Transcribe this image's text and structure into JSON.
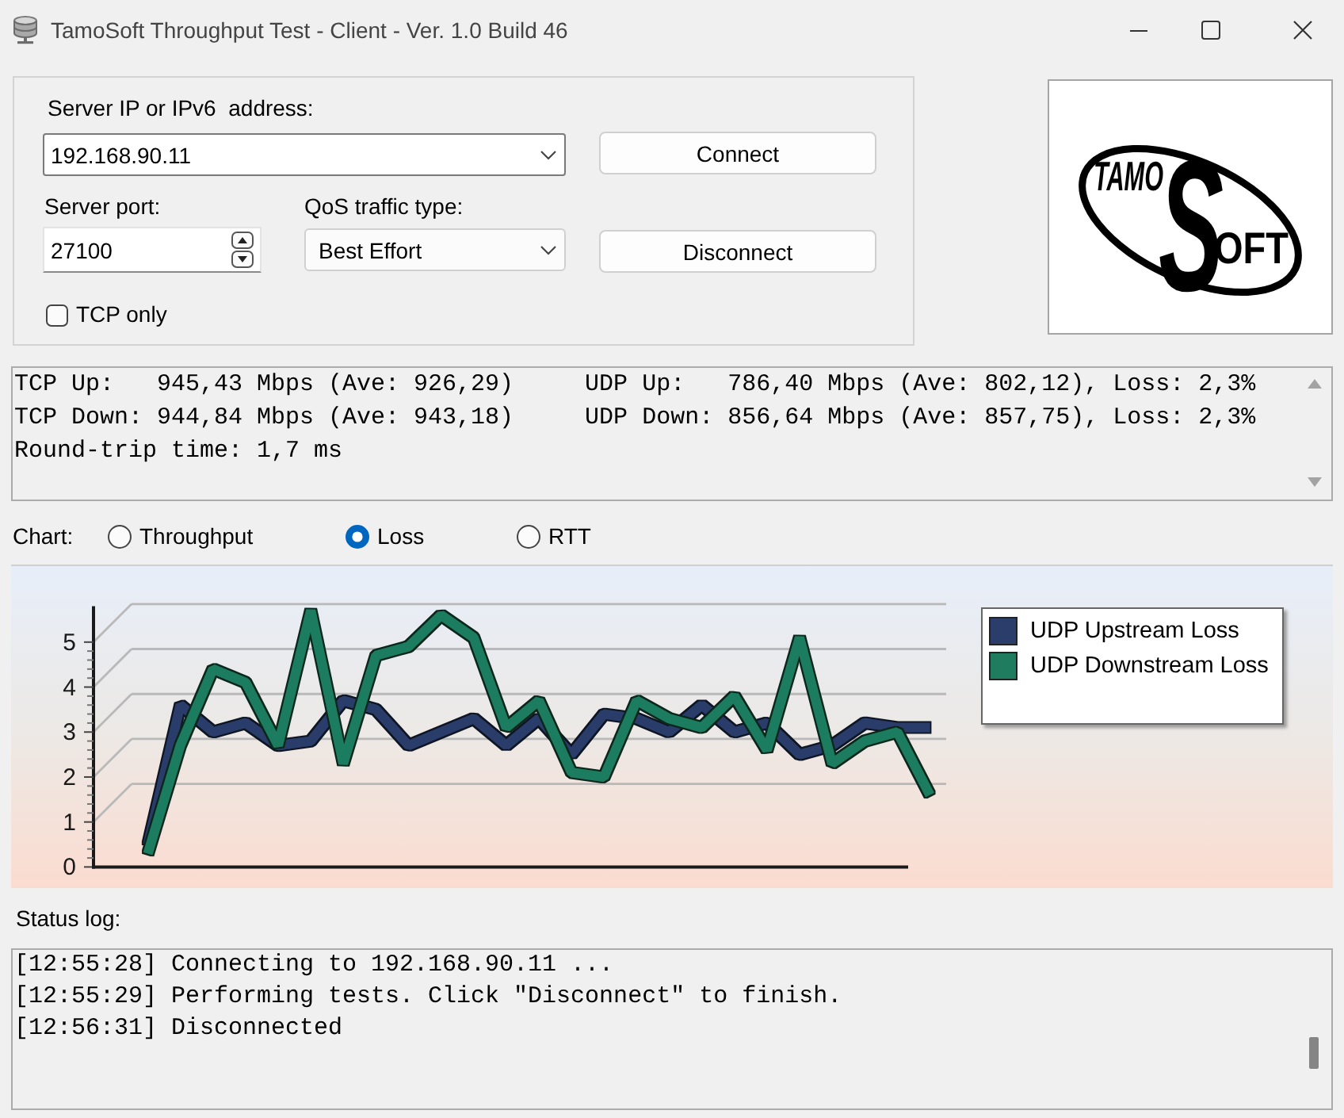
{
  "window": {
    "title": "TamoSoft Throughput Test - Client - Ver. 1.0 Build 46"
  },
  "connection": {
    "server_label": "Server IP or IPv6  address:",
    "server_value": "192.168.90.11",
    "connect_button": "Connect",
    "port_label": "Server port:",
    "port_value": "27100",
    "qos_label": "QoS traffic type:",
    "qos_value": "Best Effort",
    "disconnect_button": "Disconnect",
    "tcp_only": {
      "label": "TCP only",
      "checked": false
    }
  },
  "logo": {
    "words": [
      "TAMO",
      "S",
      "OFT"
    ]
  },
  "stats": {
    "lines": [
      "TCP Up:   945,43 Mbps (Ave: 926,29)     UDP Up:   786,40 Mbps (Ave: 802,12), Loss: 2,3%",
      "TCP Down: 944,84 Mbps (Ave: 943,18)     UDP Down: 856,64 Mbps (Ave: 857,75), Loss: 2,3%",
      "Round-trip time: 1,7 ms"
    ]
  },
  "chart_selector": {
    "label": "Chart:",
    "options": [
      {
        "label": "Throughput",
        "selected": false
      },
      {
        "label": "Loss",
        "selected": true
      },
      {
        "label": "RTT",
        "selected": false
      }
    ]
  },
  "chart": {
    "chart_data": {
      "type": "line",
      "ylim": [
        0,
        5.8
      ],
      "yticks": [
        0,
        1,
        2,
        3,
        4,
        5
      ],
      "series": [
        {
          "name": "UDP Upstream Loss",
          "color": "#2b3e6b",
          "values": [
            0.5,
            3.6,
            3.0,
            3.2,
            2.7,
            2.8,
            3.7,
            3.5,
            2.7,
            3.0,
            3.3,
            2.7,
            3.3,
            2.5,
            3.4,
            3.3,
            3.0,
            3.6,
            3.0,
            3.2,
            2.5,
            2.7,
            3.2,
            3.1,
            3.1
          ]
        },
        {
          "name": "UDP Downstream Loss",
          "color": "#1f7c5f",
          "values": [
            0.3,
            2.7,
            4.4,
            4.1,
            2.7,
            5.7,
            2.3,
            4.7,
            4.9,
            5.6,
            5.1,
            3.1,
            3.7,
            2.1,
            2.0,
            3.7,
            3.3,
            3.1,
            3.8,
            2.6,
            5.1,
            2.3,
            2.8,
            3.0,
            1.6
          ]
        }
      ]
    }
  },
  "status_log": {
    "label": "Status log:",
    "lines": [
      "[12:55:28] Connecting to 192.168.90.11 ...",
      "[12:55:29] Performing tests. Click \"Disconnect\" to finish.",
      "[12:56:31] Disconnected"
    ]
  }
}
